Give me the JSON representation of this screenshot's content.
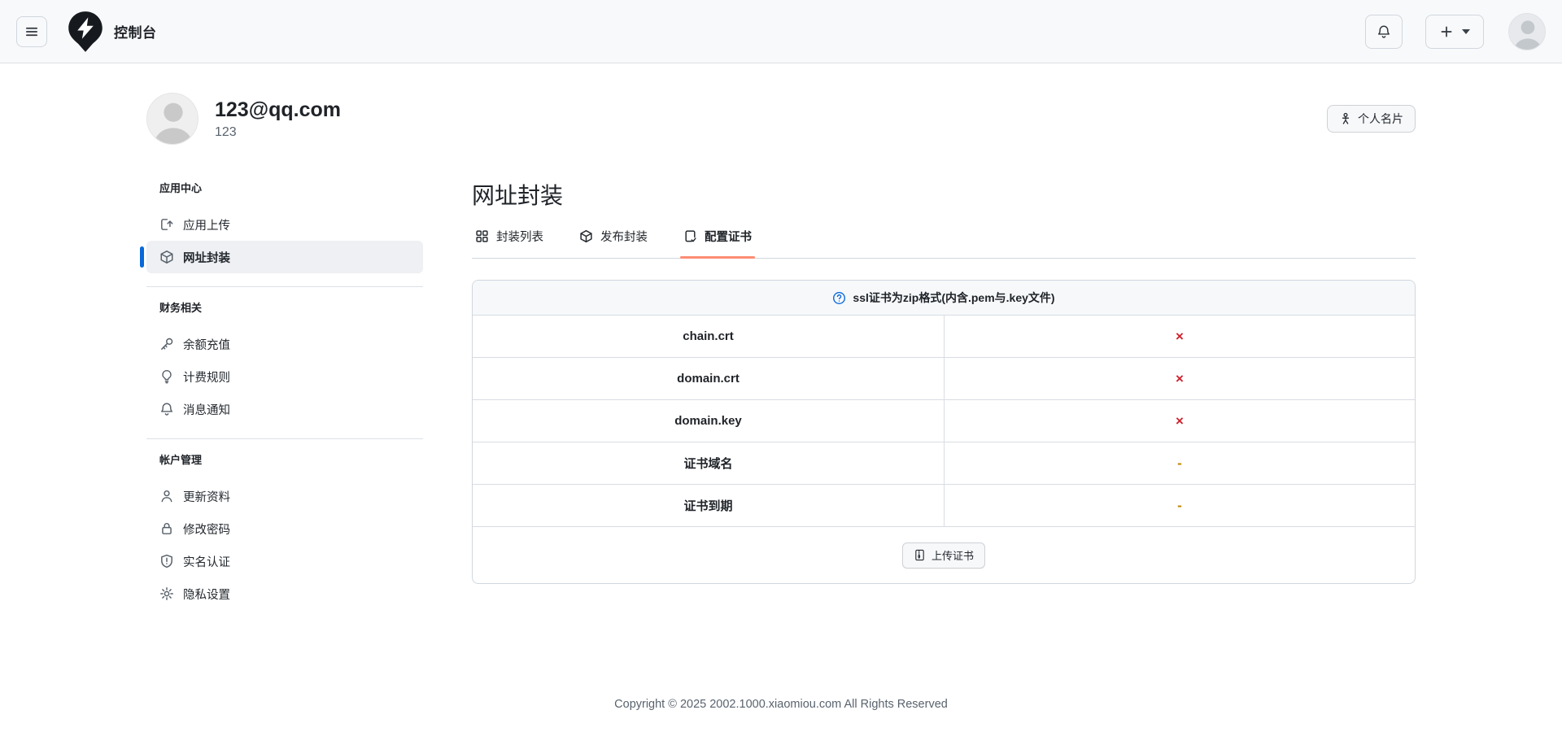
{
  "colors": {
    "accent_blue": "#0969da",
    "active_tab_underline": "#fd8c73",
    "status_missing": "#cf222e",
    "status_empty": "#bf8700"
  },
  "topbar": {
    "title": "控制台",
    "icons": {
      "menu": "hamburger-icon",
      "logo": "lightning-pin-logo",
      "notifications": "bell-icon",
      "create": "plus-dropdown-icon",
      "avatar": "user-avatar"
    }
  },
  "profile": {
    "email": "123@qq.com",
    "username": "123",
    "card_button_label": "个人名片"
  },
  "sidebar": {
    "sections": [
      {
        "heading": "应用中心",
        "items": [
          {
            "label": "应用上传",
            "icon": "upload-icon",
            "selected": false
          },
          {
            "label": "网址封装",
            "icon": "package-icon",
            "selected": true
          }
        ]
      },
      {
        "heading": "财务相关",
        "items": [
          {
            "label": "余额充值",
            "icon": "key-icon",
            "selected": false
          },
          {
            "label": "计费规则",
            "icon": "lightbulb-icon",
            "selected": false
          },
          {
            "label": "消息通知",
            "icon": "bell-icon",
            "selected": false
          }
        ]
      },
      {
        "heading": "帐户管理",
        "items": [
          {
            "label": "更新资料",
            "icon": "person-icon",
            "selected": false
          },
          {
            "label": "修改密码",
            "icon": "lock-icon",
            "selected": false
          },
          {
            "label": "实名认证",
            "icon": "shield-icon",
            "selected": false
          },
          {
            "label": "隐私设置",
            "icon": "gear-icon",
            "selected": false
          }
        ]
      }
    ]
  },
  "main": {
    "title": "网址封装",
    "tabs": [
      {
        "label": "封装列表",
        "icon": "grid-icon",
        "active": false
      },
      {
        "label": "发布封装",
        "icon": "package-icon",
        "active": false
      },
      {
        "label": "配置证书",
        "icon": "file-check-icon",
        "active": true
      }
    ],
    "cert_table": {
      "notice": "ssl证书为zip格式(内含.pem与.key文件)",
      "notice_icon": "question-circle-icon",
      "rows": [
        {
          "label": "chain.crt",
          "status": "×",
          "status_type": "missing"
        },
        {
          "label": "domain.crt",
          "status": "×",
          "status_type": "missing"
        },
        {
          "label": "domain.key",
          "status": "×",
          "status_type": "missing"
        },
        {
          "label": "证书域名",
          "status": "-",
          "status_type": "empty"
        },
        {
          "label": "证书到期",
          "status": "-",
          "status_type": "empty"
        }
      ],
      "upload_button_label": "上传证书"
    }
  },
  "footer": {
    "copyright": "Copyright © 2025 2002.1000.xiaomiou.com All Rights Reserved"
  }
}
